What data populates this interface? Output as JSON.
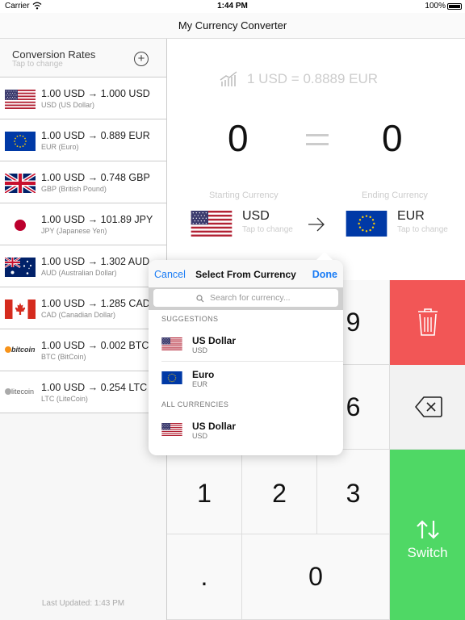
{
  "status_bar": {
    "carrier": "Carrier",
    "time": "1:44 PM",
    "battery": "100%"
  },
  "nav": {
    "title": "My Currency Converter"
  },
  "sidebar": {
    "header_title": "Conversion Rates",
    "header_hint": "Tap to change",
    "add_symbol": "+",
    "rates": [
      {
        "amount": "1.00 USD",
        "arrow": "→",
        "result": "1.000 USD",
        "name": "USD (US Dollar)",
        "flag": "us-flag-icon"
      },
      {
        "amount": "1.00 USD",
        "arrow": "→",
        "result": "0.889 EUR",
        "name": "EUR (Euro)",
        "flag": "eu-flag-icon"
      },
      {
        "amount": "1.00 USD",
        "arrow": "→",
        "result": "0.748 GBP",
        "name": "GBP (British Pound)",
        "flag": "uk-flag-icon"
      },
      {
        "amount": "1.00 USD",
        "arrow": "→",
        "result": "101.89 JPY",
        "name": "JPY (Japanese Yen)",
        "flag": "japan-flag-icon"
      },
      {
        "amount": "1.00 USD",
        "arrow": "→",
        "result": "1.302 AUD",
        "name": "AUD (Australian Dollar)",
        "flag": "australia-flag-icon"
      },
      {
        "amount": "1.00 USD",
        "arrow": "→",
        "result": "1.285 CAD",
        "name": "CAD (Canadian Dollar)",
        "flag": "canada-flag-icon"
      },
      {
        "amount": "1.00 USD",
        "arrow": "→",
        "result": "0.002 BTC",
        "name": "BTC (BitCoin)",
        "flag": "bitcoin-logo-icon",
        "logo_text": "bitcoin"
      },
      {
        "amount": "1.00 USD",
        "arrow": "→",
        "result": "0.254 LTC",
        "name": "LTC (LiteCoin)",
        "flag": "litecoin-logo-icon",
        "logo_text": "litecoin"
      }
    ],
    "footer": "Last Updated: 1:43 PM"
  },
  "converter": {
    "rate_text": "1 USD = 0.8889 EUR",
    "input_value": "0",
    "output_value": "0",
    "starting_label": "Starting Currency",
    "ending_label": "Ending Currency",
    "starting_code": "USD",
    "ending_code": "EUR",
    "tap_hint": "Tap to change"
  },
  "keypad": {
    "keys": [
      "9",
      "6",
      "1",
      "2",
      "3",
      ".",
      "0"
    ],
    "switch_label": "Switch"
  },
  "popover": {
    "cancel": "Cancel",
    "title": "Select From Currency",
    "done": "Done",
    "search_placeholder": "Search for currency...",
    "suggestions_header": "SUGGESTIONS",
    "all_header": "ALL CURRENCIES",
    "suggestions": [
      {
        "name": "US Dollar",
        "code": "USD"
      },
      {
        "name": "Euro",
        "code": "EUR"
      }
    ],
    "all": [
      {
        "name": "US Dollar",
        "code": "USD"
      }
    ]
  },
  "colors": {
    "accent": "#1a7cf5",
    "delete": "#f25656",
    "switch": "#4fd865"
  }
}
